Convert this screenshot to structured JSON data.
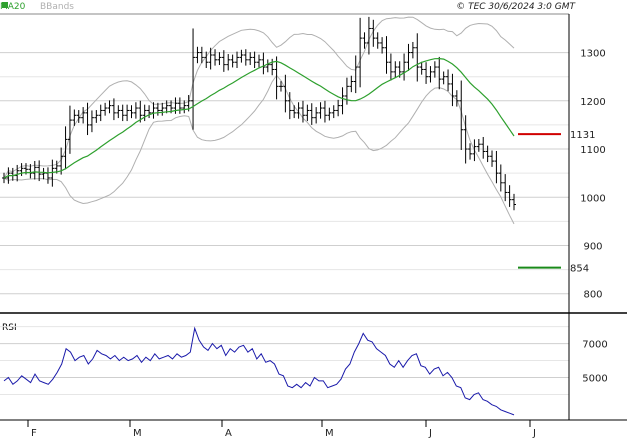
{
  "header": {
    "legend_ma": "MA20",
    "legend_bb": "BBands",
    "copyright": "© TEC 30/6/2024 3:0 GMT",
    "colors": {
      "ma": "#2ea02e",
      "bb": "#b0b0b0",
      "bars": "#000000",
      "rsi": "#1a1aaa",
      "marker_red": "#d00000",
      "marker_green": "#1a8a1a"
    }
  },
  "chart_data": [
    {
      "type": "line",
      "title": "",
      "ylabel": "",
      "ylim": [
        760,
        1380
      ],
      "y_ticks": [
        800,
        900,
        1000,
        1100,
        1200,
        1300
      ],
      "y_tick_labels": [
        "800",
        "900",
        "1000",
        "1100",
        "1200",
        "1300"
      ],
      "x_month_labels": [
        "F",
        "M",
        "A",
        "M",
        "J",
        "J"
      ],
      "series": [
        {
          "kind": "ohlc_close",
          "values": [
            1040,
            1050,
            1045,
            1055,
            1060,
            1058,
            1050,
            1062,
            1048,
            1050,
            1040,
            1060,
            1065,
            1085,
            1120,
            1160,
            1170,
            1165,
            1175,
            1150,
            1165,
            1170,
            1180,
            1185,
            1190,
            1175,
            1180,
            1170,
            1180,
            1175,
            1185,
            1170,
            1180,
            1175,
            1185,
            1180,
            1185,
            1190,
            1185,
            1195,
            1185,
            1190,
            1200,
            1290,
            1300,
            1290,
            1280,
            1295,
            1285,
            1290,
            1275,
            1285,
            1280,
            1290,
            1295,
            1285,
            1290,
            1280,
            1285,
            1270,
            1275,
            1265,
            1230,
            1230,
            1200,
            1180,
            1175,
            1185,
            1170,
            1180,
            1165,
            1175,
            1185,
            1170,
            1175,
            1180,
            1190,
            1210,
            1230,
            1240,
            1270,
            1330,
            1320,
            1350,
            1330,
            1320,
            1310,
            1280,
            1260,
            1270,
            1260,
            1280,
            1300,
            1310,
            1270,
            1265,
            1250,
            1260,
            1270,
            1245,
            1250,
            1235,
            1210,
            1200,
            1140,
            1100,
            1090,
            1105,
            1110,
            1095,
            1085,
            1075,
            1050,
            1030,
            1010,
            995,
            985
          ]
        },
        {
          "name": "MA20",
          "kind": "ma20"
        },
        {
          "name": "BBands",
          "kind": "bbands"
        }
      ],
      "annotations": [
        {
          "label": "1131",
          "value": 1131,
          "color": "#d00000"
        },
        {
          "label": "854",
          "value": 854,
          "color": "#1a8a1a"
        }
      ]
    },
    {
      "type": "line",
      "title": "RSI",
      "ylim": [
        25,
        88
      ],
      "y_ticks": [
        50,
        70
      ],
      "y_tick_labels": [
        "5000",
        "7000"
      ],
      "series": [
        {
          "name": "RSI",
          "values": [
            48,
            50,
            46,
            48,
            51,
            49,
            47,
            52,
            48,
            47,
            46,
            49,
            53,
            58,
            67,
            65,
            60,
            62,
            63,
            58,
            61,
            66,
            64,
            63,
            61,
            63,
            60,
            62,
            60,
            61,
            63,
            59,
            62,
            60,
            64,
            61,
            62,
            63,
            61,
            64,
            62,
            63,
            65,
            79,
            72,
            68,
            66,
            70,
            67,
            69,
            63,
            67,
            65,
            68,
            69,
            65,
            67,
            61,
            64,
            59,
            60,
            58,
            52,
            51,
            45,
            44,
            46,
            44,
            47,
            45,
            50,
            48,
            48,
            44,
            45,
            46,
            49,
            55,
            58,
            65,
            70,
            76,
            72,
            71,
            67,
            65,
            63,
            58,
            56,
            60,
            56,
            60,
            63,
            64,
            57,
            56,
            52,
            55,
            56,
            51,
            53,
            50,
            45,
            44,
            38,
            37,
            40,
            41,
            37,
            36,
            34,
            33,
            31,
            30,
            29,
            28
          ]
        }
      ]
    }
  ]
}
